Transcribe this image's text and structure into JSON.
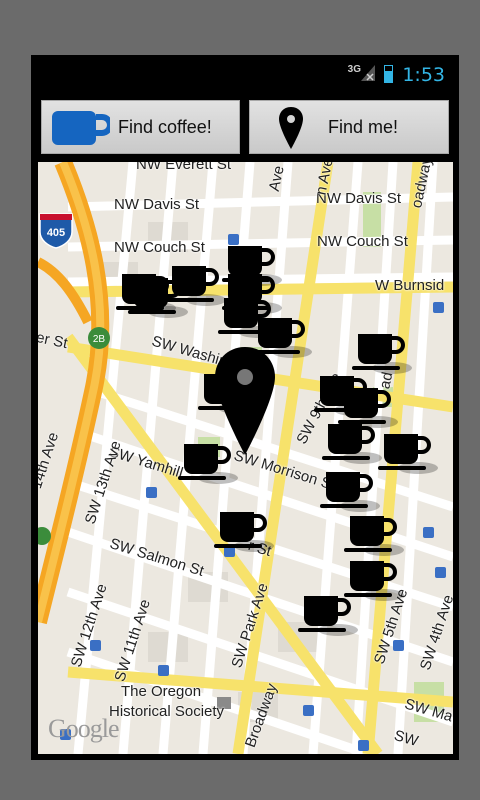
{
  "status_bar": {
    "network": "3G",
    "time": "1:53",
    "accent_color": "#33b5e5"
  },
  "toolbar": {
    "coffee_button": {
      "label": "Find coffee!",
      "icon": "coffee-cup-icon"
    },
    "find_me_button": {
      "label": "Find me!",
      "icon": "location-pin-icon"
    }
  },
  "map": {
    "highway_shield": "405",
    "exit_badge": "2B",
    "streets": [
      {
        "id": "everett",
        "text": "NW Everett St"
      },
      {
        "id": "davis1",
        "text": "NW Davis St"
      },
      {
        "id": "davis2",
        "text": "NW Davis St"
      },
      {
        "id": "couch1",
        "text": "NW Couch St"
      },
      {
        "id": "couch2",
        "text": "NW Couch St"
      },
      {
        "id": "burnside",
        "text": "W Burnsid"
      },
      {
        "id": "st-left",
        "text": "er St"
      },
      {
        "id": "washington",
        "text": "SW Washington"
      },
      {
        "id": "ninth",
        "text": "SW 9th Ave"
      },
      {
        "id": "yamhill",
        "text": "SW Yamhill"
      },
      {
        "id": "morrison",
        "text": "SW Morrison St"
      },
      {
        "id": "salmon",
        "text": "SW Salmon St"
      },
      {
        "id": "thirteenth",
        "text": "SW 13th Ave"
      },
      {
        "id": "fourteenth",
        "text": "14th Ave"
      },
      {
        "id": "twelfth",
        "text": "SW 12th Ave"
      },
      {
        "id": "eleventh",
        "text": "SW 11th Ave"
      },
      {
        "id": "park",
        "text": "SW Park Ave"
      },
      {
        "id": "broadway",
        "text": "Broadway"
      },
      {
        "id": "broadway-top",
        "text": "oadway"
      },
      {
        "id": "fifth",
        "text": "SW 5th Ave"
      },
      {
        "id": "fourth",
        "text": "SW 4th Ave"
      },
      {
        "id": "ma",
        "text": "SW Ma"
      },
      {
        "id": "ave-top",
        "text": "Ave"
      },
      {
        "id": "ave-top2",
        "text": "n Ave"
      },
      {
        "id": "ad",
        "text": "ad"
      },
      {
        "id": "st-frag",
        "text": "r St"
      },
      {
        "id": "sw-bottom",
        "text": "SW"
      }
    ],
    "poi": "The Oregon Historical Society",
    "poi_line1": "The Oregon",
    "poi_line2": "Historical Society",
    "attribution": "Google",
    "marker_count": 19
  }
}
